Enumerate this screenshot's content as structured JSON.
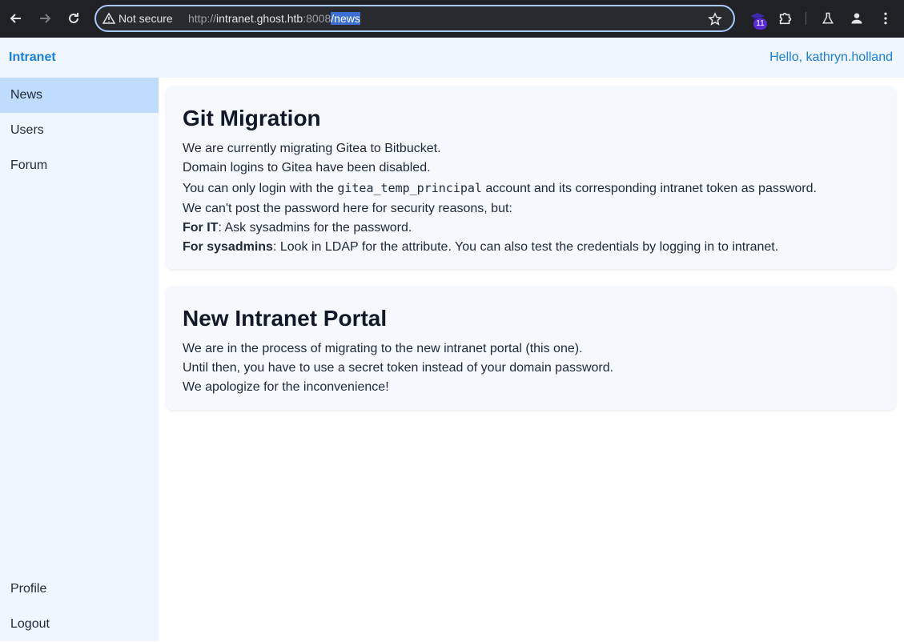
{
  "browser": {
    "security_label": "Not secure",
    "url_scheme": "http://",
    "url_host": "intranet.ghost.htb",
    "url_port": ":8008",
    "url_path": "/news",
    "extension_badge": "11"
  },
  "header": {
    "brand": "Intranet",
    "greeting": "Hello, kathryn.holland"
  },
  "sidebar": {
    "items": [
      {
        "label": "News",
        "active": true
      },
      {
        "label": "Users"
      },
      {
        "label": "Forum"
      }
    ],
    "bottom_items": [
      {
        "label": "Profile"
      },
      {
        "label": "Logout"
      }
    ]
  },
  "news": [
    {
      "title": "Git Migration",
      "line1": "We are currently migrating Gitea to Bitbucket.",
      "line2": "Domain logins to Gitea have been disabled.",
      "line3_pre": "You can only login with the ",
      "line3_code": "gitea_temp_principal",
      "line3_post": " account and its corresponding intranet token as password.",
      "line4": "We can't post the password here for security reasons, but:",
      "line5_bold": "For IT",
      "line5_rest": ": Ask sysadmins for the password.",
      "line6_bold": "For sysadmins",
      "line6_rest": ": Look in LDAP for the attribute. You can also test the credentials by logging in to intranet."
    },
    {
      "title": "New Intranet Portal",
      "line1": "We are in the process of migrating to the new intranet portal (this one).",
      "line2": "Until then, you have to use a secret token instead of your domain password.",
      "line3": "We apologize for the inconvenience!"
    }
  ]
}
